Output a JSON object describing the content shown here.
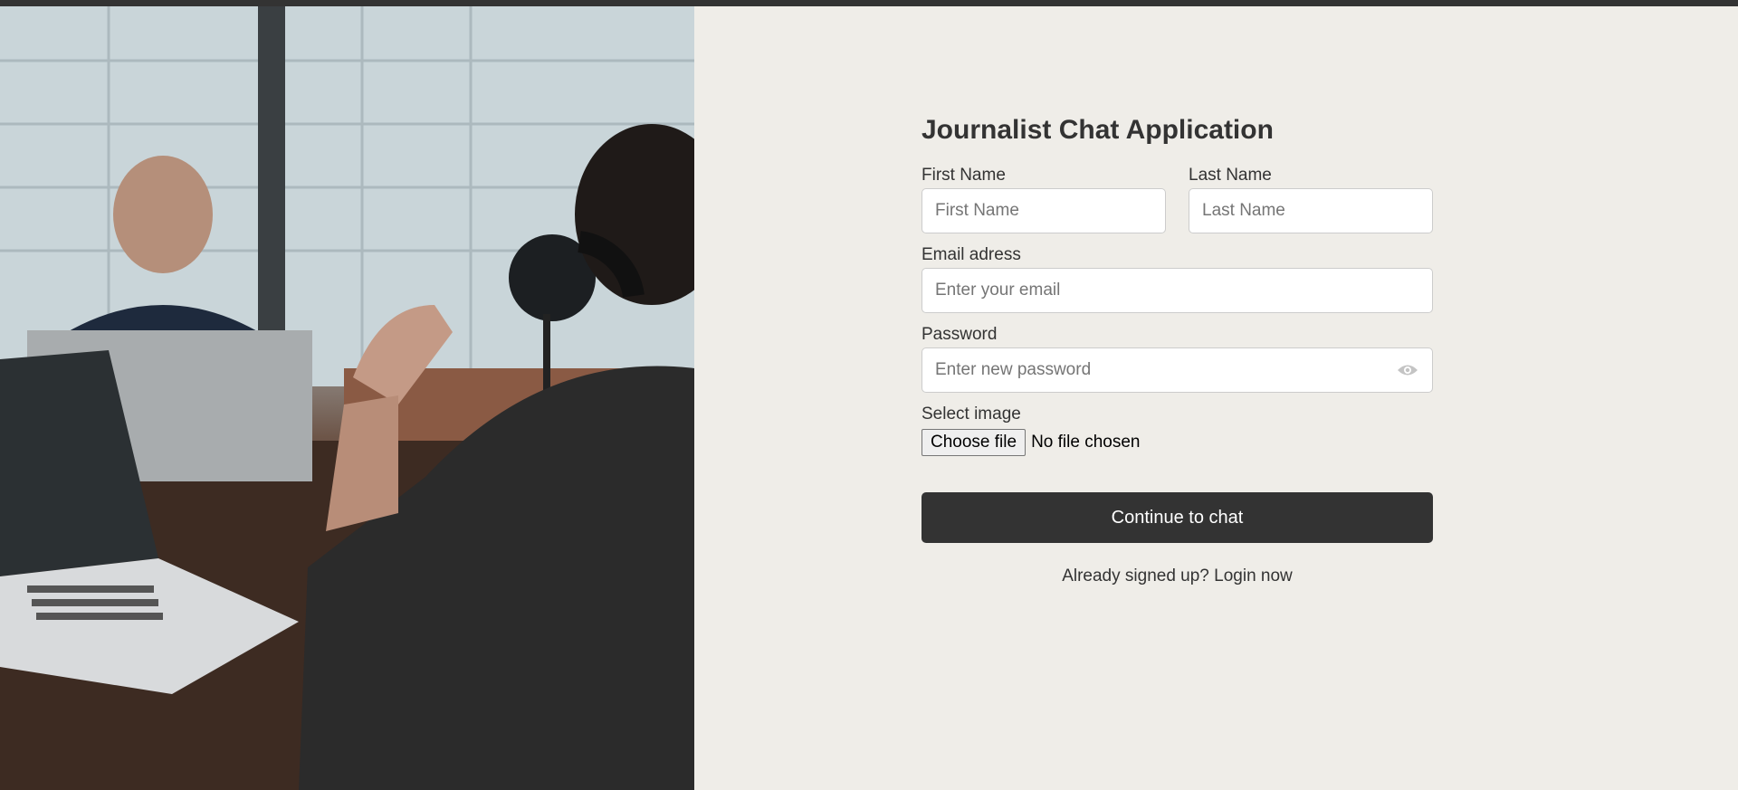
{
  "form": {
    "title": "Journalist Chat Application",
    "first_name": {
      "label": "First Name",
      "placeholder": "First Name"
    },
    "last_name": {
      "label": "Last Name",
      "placeholder": "Last Name"
    },
    "email": {
      "label": "Email adress",
      "placeholder": "Enter your email"
    },
    "password": {
      "label": "Password",
      "placeholder": "Enter new password",
      "toggle_icon": "eye-icon"
    },
    "image": {
      "label": "Select image",
      "button_label": "Choose file",
      "status": "No file chosen"
    },
    "submit_label": "Continue to chat",
    "signin_text": "Already signed up?",
    "signin_link": "Login now"
  },
  "colors": {
    "background": "#efede8",
    "accent": "#333333"
  }
}
